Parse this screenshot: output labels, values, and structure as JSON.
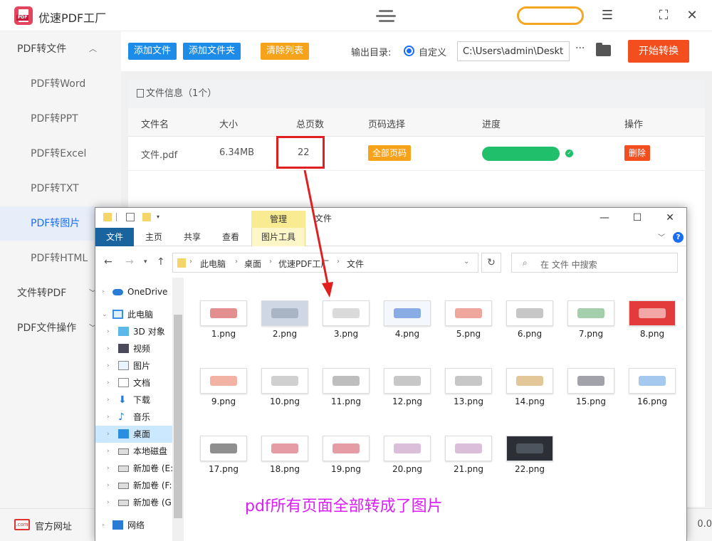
{
  "app": {
    "title": "优速PDF工厂",
    "logo_text": "PDF"
  },
  "window_controls": [
    "menu-icon",
    "fullscreen-icon",
    "close-icon"
  ],
  "sidebar": {
    "items": [
      {
        "label": "PDF转文件",
        "type": "group",
        "expanded": true
      },
      {
        "label": "PDF转Word",
        "type": "sub"
      },
      {
        "label": "PDF转PPT",
        "type": "sub"
      },
      {
        "label": "PDF转Excel",
        "type": "sub"
      },
      {
        "label": "PDF转TXT",
        "type": "sub"
      },
      {
        "label": "PDF转图片",
        "type": "sub",
        "active": true
      },
      {
        "label": "PDF转HTML",
        "type": "sub"
      },
      {
        "label": "文件转PDF",
        "type": "group",
        "expanded": false
      },
      {
        "label": "PDF文件操作",
        "type": "group",
        "expanded": false
      }
    ]
  },
  "footer": {
    "link_icon_text": ".com",
    "link": "官方网址",
    "version": "0.0"
  },
  "toolbar": {
    "add_file": "添加文件",
    "add_folder": "添加文件夹",
    "clear_list": "清除列表",
    "output_label": "输出目录:",
    "custom_label": "自定义",
    "output_path": "C:\\Users\\admin\\Deskto",
    "more": "···",
    "start": "开始转换"
  },
  "file_panel": {
    "title": "文件信息（1个）",
    "columns": [
      "文件名",
      "大小",
      "总页数",
      "页码选择",
      "进度",
      "操作"
    ],
    "rows": [
      {
        "name": "文件.pdf",
        "size": "6.34MB",
        "pages": "22",
        "page_select": "全部页码",
        "progress": 1.0,
        "action": "删除"
      }
    ]
  },
  "explorer": {
    "manage_tab": "管理",
    "window_title": "文件",
    "ribbon_tabs": [
      "文件",
      "主页",
      "共享",
      "查看",
      "图片工具"
    ],
    "breadcrumb": [
      "此电脑",
      "桌面",
      "优速PDF工厂",
      "文件"
    ],
    "search_placeholder": "在 文件 中搜索",
    "tree": [
      {
        "label": "OneDrive",
        "icon": "cloud-icon",
        "level": 0
      },
      {
        "label": "此电脑",
        "icon": "computer-icon",
        "level": 0,
        "expanded": true
      },
      {
        "label": "3D 对象",
        "icon": "cube-icon",
        "level": 1
      },
      {
        "label": "视频",
        "icon": "video-icon",
        "level": 1
      },
      {
        "label": "图片",
        "icon": "picture-icon",
        "level": 1
      },
      {
        "label": "文档",
        "icon": "document-icon",
        "level": 1
      },
      {
        "label": "下载",
        "icon": "download-icon",
        "level": 1
      },
      {
        "label": "音乐",
        "icon": "music-icon",
        "level": 1
      },
      {
        "label": "桌面",
        "icon": "desktop-icon",
        "level": 1,
        "selected": true
      },
      {
        "label": "本地磁盘",
        "icon": "drive-icon",
        "level": 1
      },
      {
        "label": "新加卷 (E:",
        "icon": "drive-icon",
        "level": 1
      },
      {
        "label": "新加卷 (F:",
        "icon": "drive-icon",
        "level": 1
      },
      {
        "label": "新加卷 (G",
        "icon": "drive-icon",
        "level": 1
      },
      {
        "label": "网络",
        "icon": "network-icon",
        "level": 0
      }
    ],
    "files": [
      "1.png",
      "2.png",
      "3.png",
      "4.png",
      "5.png",
      "6.png",
      "7.png",
      "8.png",
      "9.png",
      "10.png",
      "11.png",
      "12.png",
      "13.png",
      "14.png",
      "15.png",
      "16.png",
      "17.png",
      "18.png",
      "19.png",
      "20.png",
      "21.png",
      "22.png"
    ]
  },
  "annotation": {
    "caption": "pdf所有页面全部转成了图片",
    "highlight_color": "#e02020",
    "caption_color": "#d91ff5"
  },
  "colors": {
    "brand_red": "#e4455e",
    "primary_blue": "#1c8ce8",
    "orange": "#f7a21b",
    "start_red": "#f24e1e",
    "progress_green": "#20bf6b",
    "active_blue": "#1a6ef5"
  }
}
